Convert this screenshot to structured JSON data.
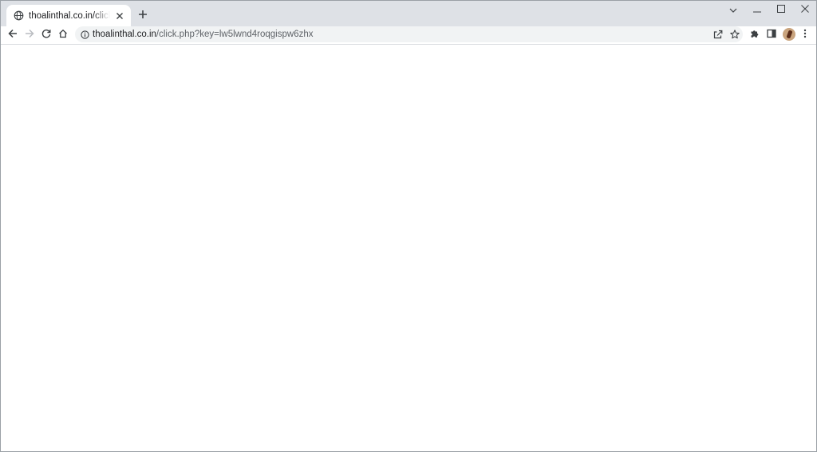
{
  "tab": {
    "title": "thoalinthal.co.in/click.php?key=lw5lwnd4roqgispw6zhx",
    "favicon": "globe-icon",
    "close_icon": "close-icon"
  },
  "new_tab_icon": "plus-icon",
  "window_controls": [
    "chevron-down-icon",
    "minimize-icon",
    "maximize-icon",
    "close-icon"
  ],
  "toolbar": {
    "back_icon": "arrow-left-icon",
    "forward_icon": "arrow-right-icon",
    "reload_icon": "reload-icon",
    "home_icon": "home-icon",
    "extensions_icon": "puzzle-icon",
    "side_panel_icon": "side-panel-icon",
    "menu_icon": "kebab-menu-icon"
  },
  "omnibox": {
    "url_host": "thoalinthal.co.in",
    "url_path": "/click.php?key=lw5lwnd4roqgispw6zhx",
    "info_icon": "info-icon",
    "share_icon": "share-icon",
    "bookmark_icon": "star-icon"
  },
  "colors": {
    "tabstrip_bg": "#dee1e6",
    "omnibox_bg": "#f1f3f4",
    "page_bg": "#ffffff",
    "icon": "#3c4043"
  }
}
